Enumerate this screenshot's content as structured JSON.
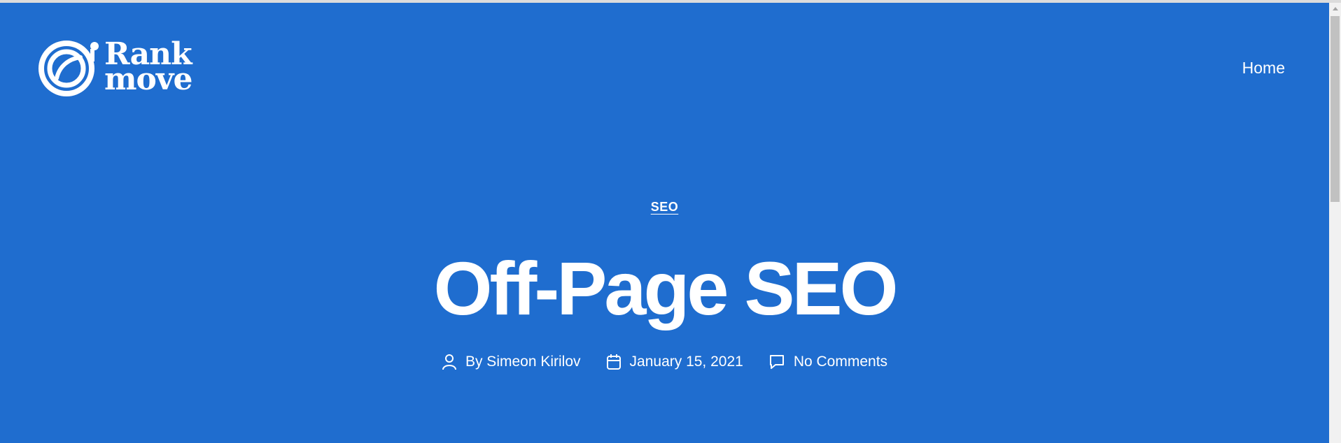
{
  "header": {
    "logo": {
      "line1": "Rank",
      "line2": "move"
    },
    "nav": {
      "home_label": "Home"
    }
  },
  "post": {
    "category": "SEO",
    "title": "Off-Page SEO",
    "meta": {
      "author": "By Simeon Kirilov",
      "date": "January 15, 2021",
      "comments": "No Comments"
    }
  },
  "colors": {
    "background": "#1f6dcf",
    "text": "#ffffff",
    "scrollbar_track": "#f1f1f1",
    "scrollbar_thumb": "#c1c1c1"
  },
  "icons": {
    "logo": "astronaut-helmet-icon",
    "author": "person-icon",
    "date": "calendar-icon",
    "comments": "comment-bubble-icon"
  }
}
